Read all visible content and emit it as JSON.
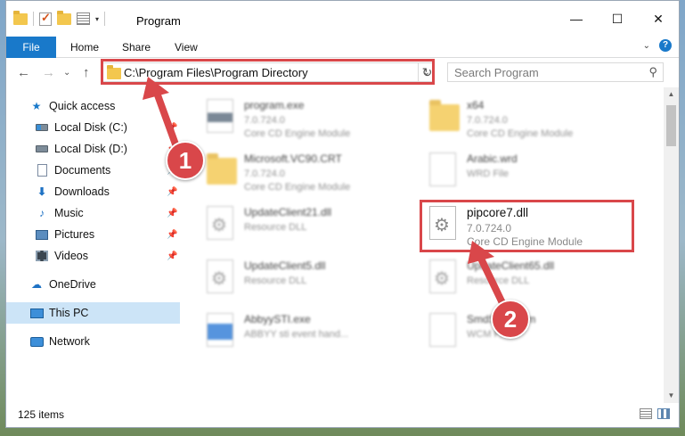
{
  "window": {
    "title": "Program",
    "controls": {
      "minimize": "—",
      "maximize": "☐",
      "close": "✕"
    }
  },
  "quick_access_toolbar": {
    "dropdown": "▾"
  },
  "ribbon": {
    "tabs": [
      "File",
      "Home",
      "Share",
      "View"
    ],
    "help_icon": "?",
    "collapse_icon": "⌄"
  },
  "nav": {
    "back": "←",
    "forward": "→",
    "recent": "⌄",
    "up": "↑",
    "address": "C:\\Program Files\\Program Directory",
    "address_dropdown": "⌄",
    "refresh": "↻",
    "search_placeholder": "Search Program",
    "search_icon": "⚲"
  },
  "sidebar": {
    "items": [
      {
        "label": "Quick access",
        "icon": "star-icon"
      },
      {
        "label": "Local Disk (C:)",
        "icon": "drive-c-icon"
      },
      {
        "label": "Local Disk (D:)",
        "icon": "drive-d-icon"
      },
      {
        "label": "Documents",
        "icon": "documents-icon"
      },
      {
        "label": "Downloads",
        "icon": "downloads-icon"
      },
      {
        "label": "Music",
        "icon": "music-icon"
      },
      {
        "label": "Pictures",
        "icon": "pictures-icon"
      },
      {
        "label": "Videos",
        "icon": "videos-icon"
      },
      {
        "label": "OneDrive",
        "icon": "onedrive-icon"
      },
      {
        "label": "This PC",
        "icon": "this-pc-icon",
        "selected": true
      },
      {
        "label": "Network",
        "icon": "network-icon"
      }
    ],
    "pin_glyph": "📌"
  },
  "files": [
    {
      "name": "program.exe",
      "version": "7.0.724.0",
      "description": "Core CD Engine Module",
      "icon": "exe-icon"
    },
    {
      "name": "x64",
      "version": "7.0.724.0",
      "description": "Core CD Engine Module",
      "icon": "folder-icon"
    },
    {
      "name": "Microsoft.VC90.CRT",
      "version": "7.0.724.0",
      "description": "Core CD Engine Module",
      "icon": "folder-icon"
    },
    {
      "name": "Arabic.wrd",
      "version": "WRD File",
      "description": "",
      "icon": "file-icon"
    },
    {
      "name": "UpdateClient21.dll",
      "version": "Resource DLL",
      "description": "",
      "icon": "dll-icon"
    },
    {
      "name": "pipcore7.dll",
      "version": "7.0.724.0",
      "description": "Core CD Engine Module",
      "icon": "dll-icon",
      "highlighted": true
    },
    {
      "name": "UpdateClient5.dll",
      "version": "Resource DLL",
      "description": "",
      "icon": "dll-icon"
    },
    {
      "name": "UpdateClient65.dll",
      "version": "Resource DLL",
      "description": "",
      "icon": "dll-icon"
    },
    {
      "name": "AbbyySTI.exe",
      "version": "ABBYY sti event hand...",
      "description": "",
      "icon": "exe-blue-icon"
    },
    {
      "name": "SmdSvc...ecm",
      "version": "WCM File",
      "description": "",
      "icon": "file-icon"
    }
  ],
  "scrollbar": {
    "up": "▲",
    "down": "▼"
  },
  "status": {
    "item_count": "125 items"
  },
  "annotations": {
    "badge_1": "1",
    "badge_2": "2",
    "color": "#d9474a"
  }
}
